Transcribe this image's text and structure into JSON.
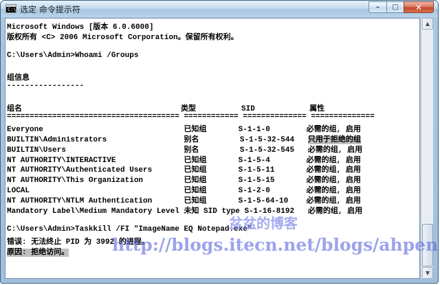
{
  "window": {
    "title": "选定 命令提示符",
    "icon_label": "C:\\",
    "icon": "cmd-icon",
    "controls": {
      "minimize": "minimize-icon",
      "maximize": "maximize-icon",
      "close": "close-icon"
    }
  },
  "console": {
    "lines": [
      {
        "text": "Microsoft Windows [版本 6.0.6000]"
      },
      {
        "text": "版权所有 <C> 2006 Microsoft Corporation。保留所有权利。"
      },
      {
        "text": ""
      },
      {
        "text": "C:\\Users\\Admin>Whoami /Groups"
      },
      {
        "text": ""
      },
      {
        "text": "组信息"
      },
      {
        "text": "-----------------"
      },
      {
        "text": ""
      },
      {
        "text": "组名                                   类型          SID            属性"
      },
      {
        "text": "====================================== ============ ============== =============="
      },
      {
        "text": "Everyone                               已知组       S-1-1-0        必需的组, 启用"
      },
      {
        "text": "BUILTIN\\Administrators                 别名         S-1-5-32-544   ",
        "highlight": "只用于拒绝的组"
      },
      {
        "text": "BUILTIN\\Users                          别名         S-1-5-32-545   必需的组, 启用"
      },
      {
        "text": "NT AUTHORITY\\INTERACTIVE               已知组       S-1-5-4        必需的组, 启用"
      },
      {
        "text": "NT AUTHORITY\\Authenticated Users       已知组       S-1-5-11       必需的组, 启用"
      },
      {
        "text": "NT AUTHORITY\\This Organization         已知组       S-1-5-15       必需的组, 启用"
      },
      {
        "text": "LOCAL                                  已知组       S-1-2-0        必需的组, 启用"
      },
      {
        "text": "NT AUTHORITY\\NTLM Authentication       已知组       S-1-5-64-10    必需的组, 启用"
      },
      {
        "text": "Mandatory Label\\Medium Mandatory Level 未知 SID type S-1-16-8192   必需的组, 启用"
      },
      {
        "text": ""
      },
      {
        "text": "C:\\Users\\Admin>Taskkill /FI \"ImageName EQ Notepad.exe\""
      },
      {
        "text": "错误: 无法终止 PID 为 3992 的进程。"
      },
      {
        "text": "",
        "highlight": "原因: 拒绝访问。"
      }
    ]
  },
  "watermark": {
    "title": "盆盆的博客",
    "url": "http://blogs.itecn.net/blogs/ahpeng"
  },
  "scrollbar": {
    "up": "scroll-up-icon",
    "down": "scroll-down-icon"
  }
}
